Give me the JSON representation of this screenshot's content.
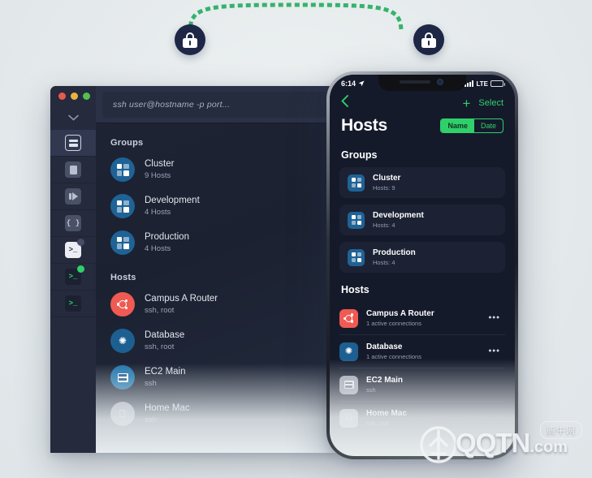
{
  "secure_link": {
    "left_lock_icon": "lock-icon",
    "right_lock_icon": "lock-icon",
    "line_color": "#34b36b",
    "line_style": "dotted"
  },
  "desktop": {
    "window_controls": {
      "close": "close-button",
      "minimize": "minimize-button",
      "maximize": "maximize-button"
    },
    "collapse_icon": "chevron-down-icon",
    "terminal": {
      "placeholder": "ssh user@hostname -p port..."
    },
    "sidebar_items": [
      {
        "name": "hosts-rail-item",
        "icon": "server-icon",
        "active": true,
        "badge": ""
      },
      {
        "name": "snippets-rail-item",
        "icon": "document-icon",
        "active": false,
        "badge": ""
      },
      {
        "name": "portforward-rail-item",
        "icon": "port-forward-icon",
        "active": false,
        "badge": ""
      },
      {
        "name": "keys-rail-item",
        "icon": "braces-icon",
        "active": false,
        "badge": ""
      },
      {
        "name": "terminal-rail-item-1",
        "icon": "terminal-icon",
        "active": false,
        "badge": "grey"
      },
      {
        "name": "terminal-rail-item-2",
        "icon": "terminal-icon",
        "active": false,
        "badge": "green"
      },
      {
        "name": "terminal-rail-item-3",
        "icon": "terminal-icon",
        "active": false,
        "badge": ""
      }
    ],
    "groups_title": "Groups",
    "groups": [
      {
        "name": "Cluster",
        "subtitle": "9 Hosts",
        "icon": "group-icon"
      },
      {
        "name": "Development",
        "subtitle": "4 Hosts",
        "icon": "group-icon"
      },
      {
        "name": "Production",
        "subtitle": "4 Hosts",
        "icon": "group-icon"
      }
    ],
    "hosts_title": "Hosts",
    "hosts": [
      {
        "name": "Campus A Router",
        "subtitle": "ssh, root",
        "icon": "ubuntu-icon"
      },
      {
        "name": "Database",
        "subtitle": "ssh, root",
        "icon": "mariadb-gear-icon"
      },
      {
        "name": "EC2 Main",
        "subtitle": "ssh",
        "icon": "server-icon"
      },
      {
        "name": "Home Mac",
        "subtitle": "ssh",
        "icon": "apple-icon"
      }
    ]
  },
  "phone": {
    "status_bar": {
      "time": "6:14",
      "location_icon": "location-arrow-icon",
      "carrier": "LTE",
      "signal_icon": "signal-bars-icon",
      "battery_icon": "battery-icon"
    },
    "nav": {
      "back_icon": "chevron-left-icon",
      "add_icon": "plus-icon",
      "select_label": "Select"
    },
    "title": "Hosts",
    "sort": {
      "active": "Name",
      "inactive": "Date",
      "accent": "#2fd06a"
    },
    "groups_title": "Groups",
    "groups": [
      {
        "name": "Cluster",
        "subtitle": "Hosts: 9",
        "icon": "group-icon"
      },
      {
        "name": "Development",
        "subtitle": "Hosts: 4",
        "icon": "group-icon"
      },
      {
        "name": "Production",
        "subtitle": "Hosts: 4",
        "icon": "group-icon"
      }
    ],
    "hosts_title": "Hosts",
    "hosts": [
      {
        "name": "Campus A Router",
        "subtitle": "1 active connections",
        "icon": "ubuntu-icon",
        "more": "more-icon"
      },
      {
        "name": "Database",
        "subtitle": "1 active connections",
        "icon": "mariadb-gear-icon",
        "more": "more-icon"
      },
      {
        "name": "EC2 Main",
        "subtitle": "ssh",
        "icon": "server-icon",
        "more": ""
      },
      {
        "name": "Home Mac",
        "subtitle": "ssh, osx",
        "icon": "apple-icon",
        "more": ""
      }
    ]
  },
  "watermark": {
    "brand": "QQTN",
    "tld": ".com",
    "cn_label": "腾牛网"
  }
}
